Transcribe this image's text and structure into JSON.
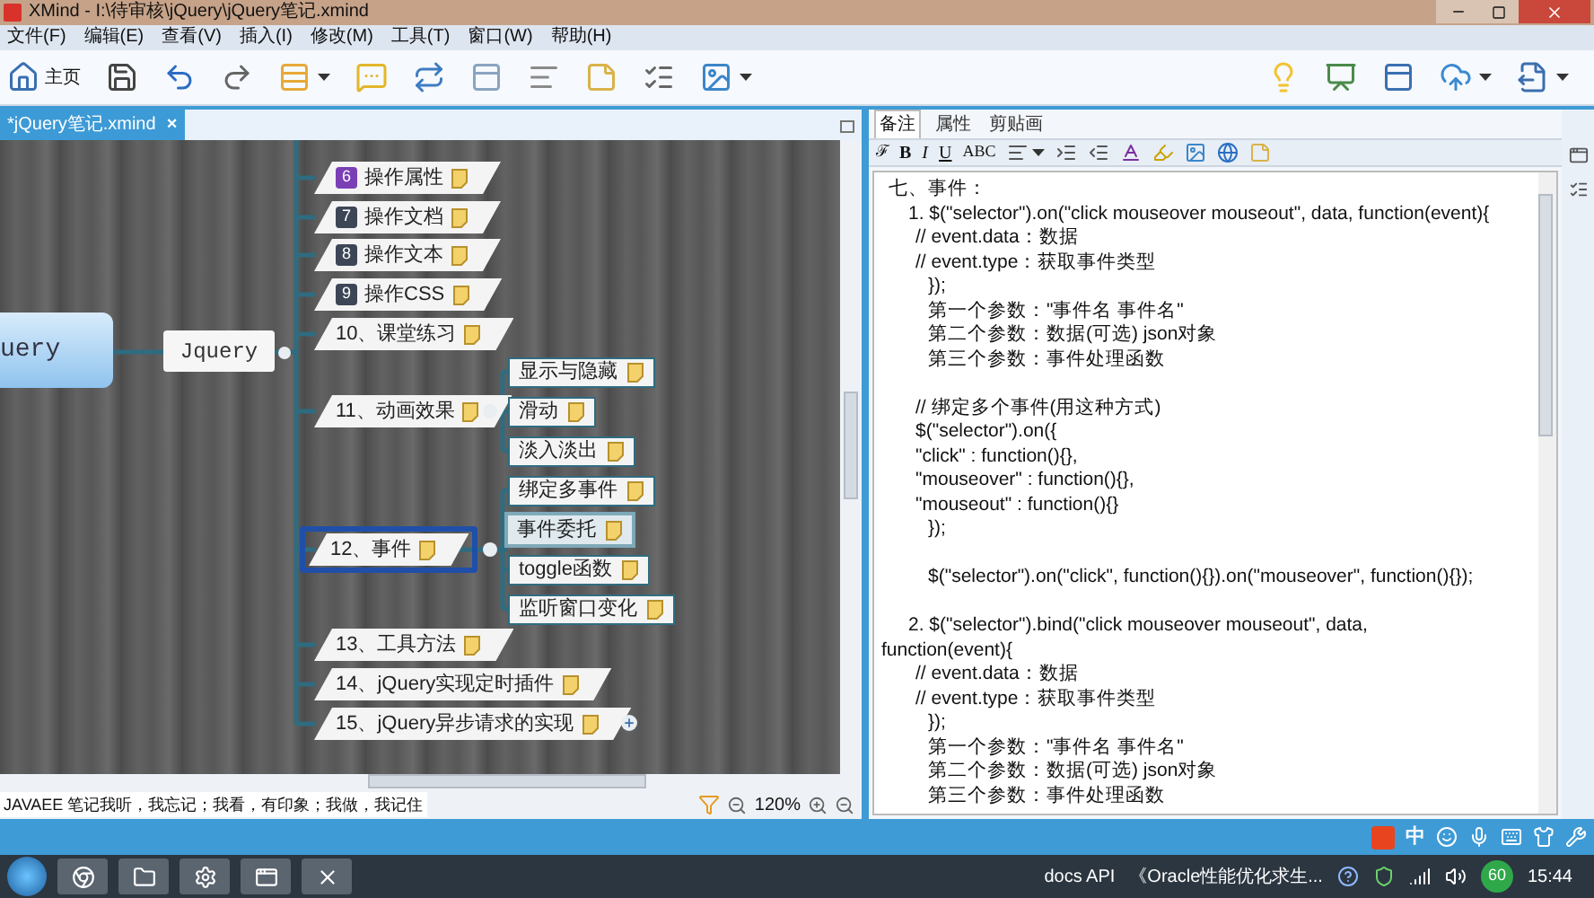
{
  "window": {
    "title": "XMind - I:\\待审核\\jQuery\\jQuery笔记.xmind"
  },
  "menu": [
    "文件(F)",
    "编辑(E)",
    "查看(V)",
    "插入(I)",
    "修改(M)",
    "工具(T)",
    "窗口(W)",
    "帮助(H)"
  ],
  "toolbar": {
    "home_label": "主页"
  },
  "editor_tab": {
    "label": "*jQuery笔记.xmind",
    "close": "×"
  },
  "mindmap": {
    "central_topic": "uery",
    "main_topic": "Jquery",
    "topics": [
      {
        "label": "操作属性",
        "badge": "6",
        "color": "#7b3fb5",
        "selected": false
      },
      {
        "label": "操作文档",
        "badge": "7",
        "color": "#3d4656",
        "selected": false
      },
      {
        "label": "操作文本",
        "badge": "8",
        "color": "#3d4656",
        "selected": false
      },
      {
        "label": "操作CSS",
        "badge": "9",
        "color": "#3d4656",
        "selected": false
      },
      {
        "label": "10、课堂练习",
        "selected": false
      },
      {
        "label": "11、动画效果",
        "selected": false,
        "children": [
          {
            "label": "显示与隐藏",
            "highlighted": false
          },
          {
            "label": "滑动",
            "highlighted": false
          },
          {
            "label": "淡入淡出",
            "highlighted": false
          }
        ]
      },
      {
        "label": "12、事件",
        "selected": true,
        "children": [
          {
            "label": "绑定多事件",
            "highlighted": false
          },
          {
            "label": "事件委托",
            "highlighted": true
          },
          {
            "label": "toggle函数",
            "highlighted": false
          },
          {
            "label": "监听窗口变化",
            "highlighted": false
          }
        ]
      },
      {
        "label": "13、工具方法",
        "selected": false
      },
      {
        "label": "14、jQuery实现定时插件",
        "selected": false
      },
      {
        "label": "15、jQuery异步请求的实现",
        "selected": false,
        "collapsed": true
      }
    ]
  },
  "status": {
    "text": "JAVAEE 笔记我听，我忘记；我看，有印象；我做，我记住",
    "zoom": "120%"
  },
  "side_tabs": [
    {
      "label": "备注",
      "selected": true
    },
    {
      "label": "属性",
      "selected": false
    },
    {
      "label": "剪贴画",
      "selected": false
    }
  ],
  "format_buttons": [
    "ℱ",
    "B",
    "I",
    "U",
    "ABC"
  ],
  "notes": [
    {
      "kind": "h",
      "text": "七、事件："
    },
    {
      "kind": "item",
      "text": "1. $(\"selector\").on(\"click mouseover mouseout\", data, function(event){"
    },
    {
      "kind": "comment",
      "text": "// event.data：数据"
    },
    {
      "kind": "comment",
      "text": "// event.type：获取事件类型"
    },
    {
      "kind": "param",
      "text": "});"
    },
    {
      "kind": "param",
      "text": "第一个参数：\"事件名 事件名\""
    },
    {
      "kind": "param",
      "text": "第二个参数：数据(可选) json对象"
    },
    {
      "kind": "param",
      "text": "第三个参数：事件处理函数"
    },
    {
      "kind": "gap"
    },
    {
      "kind": "comment",
      "text": "// 绑定多个事件(用这种方式)"
    },
    {
      "kind": "comment",
      "text": "$(\"selector\").on({"
    },
    {
      "kind": "comment",
      "text": "\"click\" : function(){},"
    },
    {
      "kind": "comment",
      "text": "\"mouseover\" : function(){},"
    },
    {
      "kind": "comment",
      "text": "\"mouseout\" : function(){}"
    },
    {
      "kind": "param",
      "text": "});"
    },
    {
      "kind": "gap"
    },
    {
      "kind": "param",
      "text": "$(\"selector\").on(\"click\", function(){}).on(\"mouseover\", function(){});"
    },
    {
      "kind": "gap"
    },
    {
      "kind": "item",
      "text": "2. $(\"selector\").bind(\"click mouseover mouseout\", data,"
    },
    {
      "kind": "wrap",
      "text": "function(event){"
    },
    {
      "kind": "comment",
      "text": "// event.data：数据"
    },
    {
      "kind": "comment",
      "text": "// event.type：获取事件类型"
    },
    {
      "kind": "param",
      "text": "});"
    },
    {
      "kind": "param",
      "text": "第一个参数：\"事件名 事件名\""
    },
    {
      "kind": "param",
      "text": "第二个参数：数据(可选) json对象"
    },
    {
      "kind": "param",
      "text": "第三个参数：事件处理函数"
    }
  ],
  "ime": {
    "label": "中"
  },
  "taskbar": {
    "items": [
      "docs API",
      "《Oracle性能优化求生..."
    ],
    "badge": "60",
    "time": "15:44"
  }
}
